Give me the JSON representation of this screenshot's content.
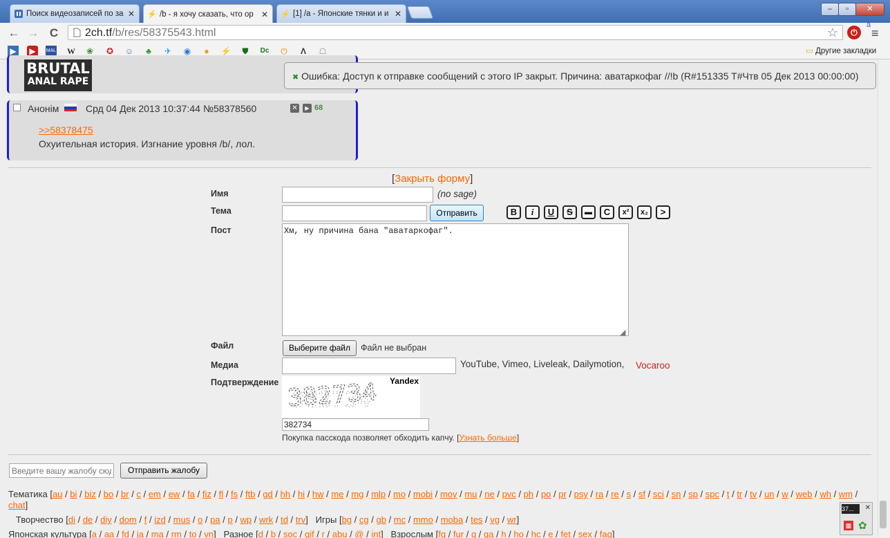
{
  "tabs": [
    {
      "title": "Поиск видеозаписей по заг",
      "icon": "pause-icon",
      "active": false
    },
    {
      "title": "/b - я хочу сказать, что ор",
      "icon": "bolt-icon",
      "active": true
    },
    {
      "title": "[1] /a - Японские тянки и и",
      "icon": "bolt-icon",
      "active": false
    }
  ],
  "address": {
    "domain": "2ch.tf",
    "path": "/b/res/58375543.html"
  },
  "bookmarks_other": "Другие закладки",
  "brutal_line1": "BRUTAL",
  "brutal_line2": "ANAL RAPE",
  "error": "Ошибка: Доступ к отправке сообщений с этого IP закрыт. Причина: аватаркофаг //!b (R#151335 T#Чтв 05 Дек 2013 00:00:00)",
  "post": {
    "author": "Анонім",
    "date": "Срд 04 Дек 2013 10:37:44",
    "number": "№58378560",
    "replies": "68",
    "reflink": ">>58378475",
    "text": "Охуительная история. Изгнание уровня /b/, лол."
  },
  "form": {
    "close_open": "[",
    "close_label": "Закрыть форму",
    "close_end": "]",
    "name_label": "Имя",
    "nosage": "(no sage)",
    "subject_label": "Тема",
    "submit": "Отправить",
    "post_label": "Пост",
    "post_text": "Хм, ну причина бана \"аватаркофаг\".",
    "markup": [
      "B",
      "i",
      "U",
      "S",
      "▬",
      "C",
      "x²",
      "x₂",
      ">"
    ],
    "file_label": "Файл",
    "choose_file": "Выберите файл",
    "no_file": "Файл не выбран",
    "media_label": "Медиа",
    "media_hint": "YouTube, Vimeo, Liveleak, Dailymotion,",
    "vocaroo": "Vocaroo",
    "captcha_label": "Подтверждение",
    "captcha_brand": "Yandex",
    "captcha_value": "382734",
    "passcode_text": "Покупка пасскода позволяет обходить капчу. [",
    "passcode_link": "Узнать больше",
    "passcode_end": "]"
  },
  "complaint": {
    "placeholder": "Введите вашу жалобу сюда",
    "button": "Отправить жалобу"
  },
  "boards": {
    "themes_label": "Тематика",
    "themes": [
      "au",
      "bi",
      "biz",
      "bo",
      "br",
      "c",
      "em",
      "ew",
      "fa",
      "fiz",
      "fl",
      "fs",
      "ftb",
      "gd",
      "hh",
      "hi",
      "hw",
      "me",
      "mg",
      "mlp",
      "mo",
      "mobi",
      "mov",
      "mu",
      "ne",
      "pvc",
      "ph",
      "po",
      "pr",
      "psy",
      "ra",
      "re",
      "s",
      "sf",
      "sci",
      "sn",
      "sp",
      "spc",
      "t",
      "tr",
      "tv",
      "un",
      "w",
      "web",
      "wh",
      "wm",
      "chat"
    ],
    "creative_label": "Творчество",
    "creative": [
      "di",
      "de",
      "diy",
      "dom",
      "f",
      "izd",
      "mus",
      "o",
      "pa",
      "p",
      "wp",
      "wrk",
      "td",
      "trv"
    ],
    "games_label": "Игры",
    "games": [
      "bg",
      "cg",
      "gb",
      "mc",
      "mmo",
      "moba",
      "tes",
      "vg",
      "wr"
    ],
    "japan_label": "Японская культура",
    "japan": [
      "a",
      "aa",
      "fd",
      "ja",
      "ma",
      "rm",
      "to",
      "vn"
    ],
    "misc_label": "Разное",
    "misc": [
      "d",
      "b",
      "soc",
      "gif",
      "r",
      "abu",
      "@",
      "int"
    ],
    "adult_label": "Взрослым",
    "adult": [
      "fg",
      "fur",
      "g",
      "ga",
      "h",
      "ho",
      "hc",
      "e",
      "fet",
      "sex",
      "fag"
    ]
  },
  "tray": {
    "label": "37..."
  }
}
